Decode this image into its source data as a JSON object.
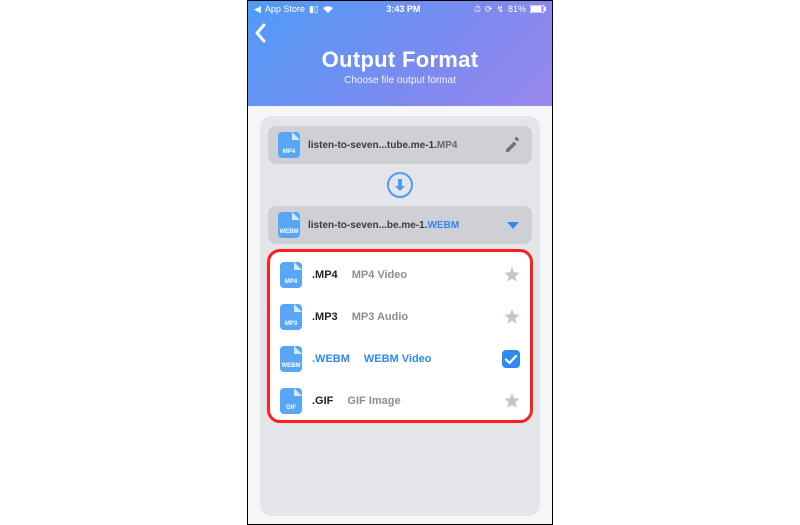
{
  "status": {
    "back_app": "App Store",
    "time": "3:43 PM",
    "battery": "81%"
  },
  "header": {
    "title": "Output Format",
    "subtitle": "Choose file output format"
  },
  "input_file": {
    "badge": "MP4",
    "name": "listen-to-seven...tube.me-1.",
    "ext": "MP4"
  },
  "output_file": {
    "badge": "WEBM",
    "name": "listen-to-seven...be.me-1.",
    "ext": "WEBM"
  },
  "formats": [
    {
      "badge": "MP4",
      "label": ".MP4",
      "desc": "MP4 Video",
      "selected": false
    },
    {
      "badge": "MP3",
      "label": ".MP3",
      "desc": "MP3 Audio",
      "selected": false
    },
    {
      "badge": "WEBM",
      "label": ".WEBM",
      "desc": "WEBM Video",
      "selected": true
    },
    {
      "badge": "GIF",
      "label": ".GIF",
      "desc": "GIF Image",
      "selected": false
    }
  ]
}
